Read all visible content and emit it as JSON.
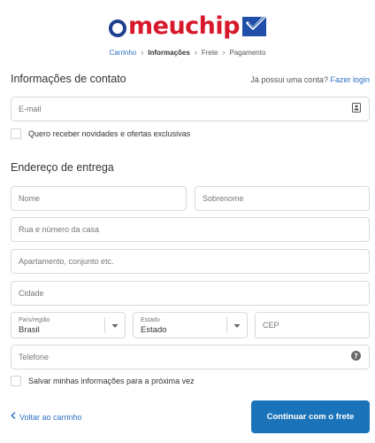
{
  "brand": {
    "wordmark": "meuchip",
    "primary_color": "#d7192b",
    "secondary_color": "#1f4fa8"
  },
  "breadcrumb": {
    "items": [
      {
        "label": "Carrinho",
        "state": "link"
      },
      {
        "label": "Informações",
        "state": "current"
      },
      {
        "label": "Frete",
        "state": "upcoming"
      },
      {
        "label": "Pagamento",
        "state": "upcoming"
      }
    ],
    "separator": "›"
  },
  "contact": {
    "title": "Informações de contato",
    "has_account_text": "Já possui uma conta?",
    "login_link": "Fazer login",
    "email_placeholder": "E-mail",
    "newsletter_label": "Quero receber novidades e ofertas exclusivas",
    "newsletter_checked": false
  },
  "shipping": {
    "title": "Endereço de entrega",
    "first_name_placeholder": "Nome",
    "last_name_placeholder": "Sobrenome",
    "address_placeholder": "Rua e número da casa",
    "apartment_placeholder": "Apartamento, conjunto etc.",
    "city_placeholder": "Cidade",
    "country_label": "País/região",
    "country_value": "Brasil",
    "state_label": "Estado",
    "state_value": "Estado",
    "zip_placeholder": "CEP",
    "phone_placeholder": "Telefone",
    "save_info_label": "Salvar minhas informações para a próxima vez",
    "save_info_checked": false
  },
  "footer": {
    "back_label": "Voltar ao carrinho",
    "continue_label": "Continuar com o frete",
    "continue_color": "#1a73b9"
  },
  "icons": {
    "email_field": "contact-card-icon",
    "phone_field": "help-circle-icon",
    "select": "chevron-down-icon",
    "back": "chevron-left-icon"
  }
}
